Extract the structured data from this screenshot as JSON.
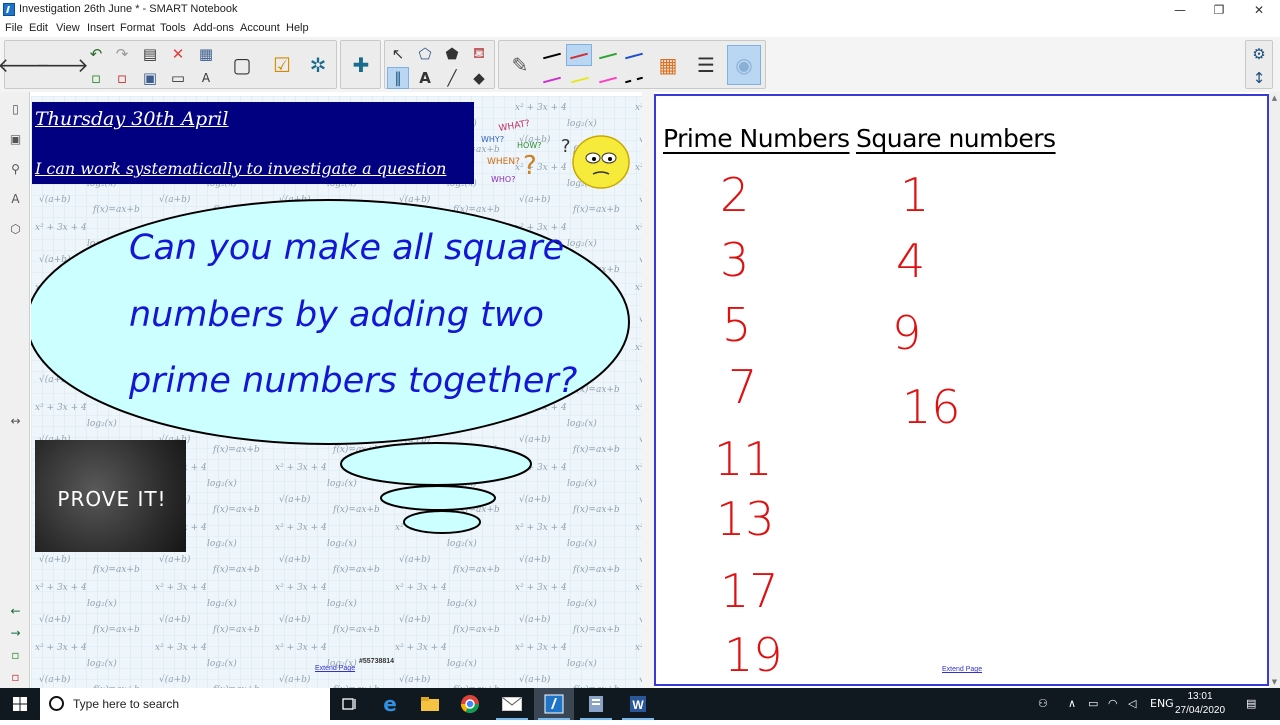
{
  "window": {
    "title": "Investigation 26th June * - SMART Notebook",
    "minimize": "—",
    "restore": "❐",
    "close": "✕"
  },
  "menu": [
    "File",
    "Edit",
    "View",
    "Insert",
    "Format",
    "Tools",
    "Add-ons",
    "Account",
    "Help"
  ],
  "left_page": {
    "header_line1": "Thursday 30th April",
    "header_line2": "I can work systematically to investigate a question",
    "cloud_lines": [
      "Can you make all square",
      "numbers by adding two",
      "prime numbers together?"
    ],
    "prove_it": "PROVE IT!",
    "extend_page": "Extend Page",
    "image_id": "#55738814"
  },
  "right_page": {
    "heading_primes": "Prime Numbers",
    "heading_squares": "Square numbers",
    "primes": [
      "2",
      "3",
      "5",
      "7",
      "11",
      "13",
      "17",
      "19"
    ],
    "squares": [
      "1",
      "4",
      "9",
      "16"
    ],
    "extend_page": "Extend Page"
  },
  "colors": {
    "header_bg": "#000080",
    "cloud_fill": "#ccffff",
    "cloud_text": "#1515d6",
    "number_red": "#e01010",
    "page_border": "#3a3ad6"
  },
  "taskbar": {
    "search_placeholder": "Type here to search",
    "language": "ENG",
    "time": "13:01",
    "date": "27/04/2020"
  }
}
